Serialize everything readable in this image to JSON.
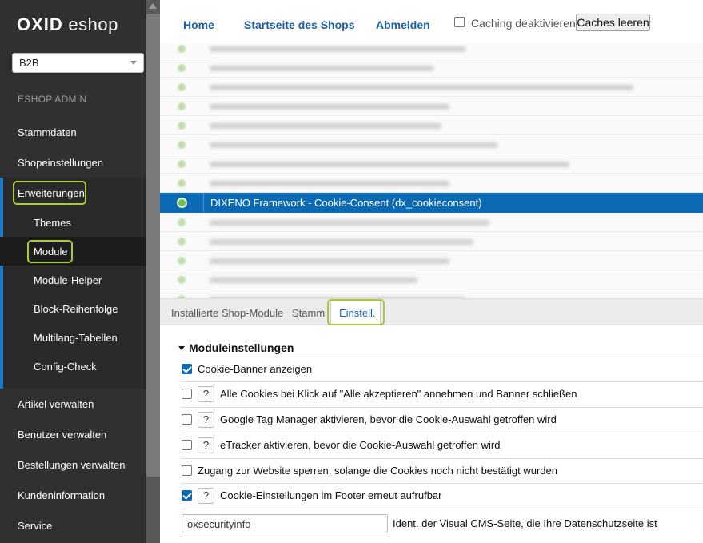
{
  "sidebar": {
    "logo_bold": "OXID",
    "logo_rest": " eshop",
    "shop_select": "B2B",
    "admin_title": "ESHOP ADMIN",
    "items": [
      {
        "label": "Stammdaten"
      },
      {
        "label": "Shopeinstellungen"
      },
      {
        "label": "Erweiterungen"
      },
      {
        "label": "Artikel verwalten"
      },
      {
        "label": "Benutzer verwalten"
      },
      {
        "label": "Bestellungen verwalten"
      },
      {
        "label": "Kundeninformation"
      },
      {
        "label": "Service"
      }
    ],
    "subitems": [
      {
        "label": "Themes"
      },
      {
        "label": "Module"
      },
      {
        "label": "Module-Helper"
      },
      {
        "label": "Block-Reihenfolge"
      },
      {
        "label": "Multilang-Tabellen"
      },
      {
        "label": "Config-Check"
      }
    ]
  },
  "topbar": {
    "home": "Home",
    "startseite": "Startseite des Shops",
    "abmelden": "Abmelden",
    "caching_label": "Caching deaktivieren",
    "clear_caches": "Caches leeren"
  },
  "modules": {
    "selected": "DIXENO Framework - Cookie-Consent (dx_cookieconsent)"
  },
  "tabs": {
    "installed": "Installierte Shop-Module",
    "stamm": "Stamm",
    "einstell": "Einstell."
  },
  "settings": {
    "heading": "Moduleinstellungen",
    "options": [
      {
        "label": "Cookie-Banner anzeigen",
        "checked": true
      },
      {
        "label": "Alle Cookies bei Klick auf \"Alle akzeptieren\" annehmen und Banner schließen",
        "checked": false,
        "help": "?"
      },
      {
        "label": "Google Tag Manager aktivieren, bevor die Cookie-Auswahl getroffen wird",
        "checked": false,
        "help": "?"
      },
      {
        "label": "eTracker aktivieren, bevor die Cookie-Auswahl getroffen wird",
        "checked": false,
        "help": "?"
      },
      {
        "label": "Zugang zur Website sperren, solange die Cookies noch nicht bestätigt wurden",
        "checked": false
      },
      {
        "label": "Cookie-Einstellungen im Footer erneut aufrufbar",
        "checked": true,
        "help": "?"
      }
    ],
    "cms_value": "oxsecurityinfo",
    "cms_label": "Ident. der Visual CMS-Seite, die Ihre Datenschutzseite ist"
  },
  "colors": {
    "accent": "#0b6ab3",
    "highlight": "#a8c93c",
    "sidebar_bg": "#303030"
  }
}
